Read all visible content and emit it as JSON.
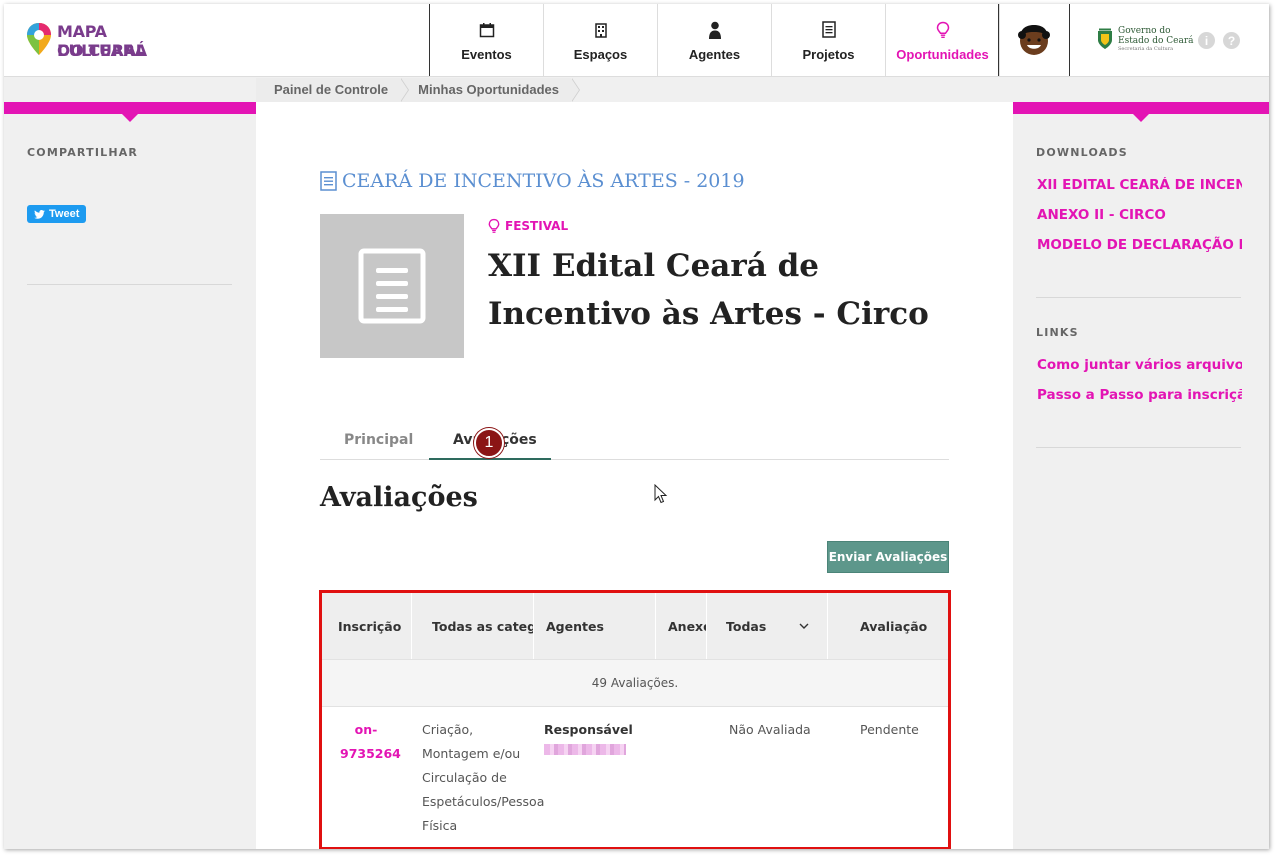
{
  "logo": {
    "line1": "MAPA CULTURAL",
    "line2": "DO CEARÁ"
  },
  "nav": [
    {
      "label": "Eventos",
      "icon": "calendar-icon"
    },
    {
      "label": "Espaços",
      "icon": "building-icon"
    },
    {
      "label": "Agentes",
      "icon": "person-icon"
    },
    {
      "label": "Projetos",
      "icon": "document-icon"
    },
    {
      "label": "Oportunidades",
      "icon": "lightbulb-icon",
      "active": true
    }
  ],
  "gov": {
    "line1": "Governo do",
    "line2": "Estado do Ceará",
    "line3": "Secretaria da Cultura"
  },
  "help_icons": {
    "info": "i",
    "help": "?"
  },
  "breadcrumb": [
    "Painel de Controle",
    "Minhas Oportunidades"
  ],
  "left_sidebar": {
    "heading": "COMPARTILHAR",
    "tweet_label": "Tweet"
  },
  "right_sidebar": {
    "downloads_heading": "DOWNLOADS",
    "downloads": [
      "XII EDITAL CEARÁ DE INCENTIVO",
      "ANEXO II - CIRCO",
      "MODELO DE DECLARAÇÃO DE"
    ],
    "links_heading": "LINKS",
    "links": [
      "Como juntar vários arquivos em",
      "Passo a Passo para inscrição"
    ]
  },
  "opportunity": {
    "parent_title": "CEARÁ DE INCENTIVO ÀS ARTES - 2019",
    "type": "FESTIVAL",
    "title": "XII Edital Ceará de Incentivo às Artes - Circo"
  },
  "tabs": {
    "principal": "Principal",
    "avaliacoes": "Avaliações",
    "marker": "1"
  },
  "section_title": "Avaliações",
  "send_button": "Enviar Avaliações",
  "table": {
    "headers": [
      "Inscrição",
      "Todas as categorias",
      "Agentes",
      "Anexos",
      "Todas",
      "Avaliação"
    ],
    "count_text": "49 Avaliações.",
    "rows": [
      {
        "inscricao": "on-9735264",
        "categoria": "Criação, Montagem e/ou Circulação de Espetáculos/Pessoa Física",
        "agente_label": "Responsável",
        "status": "Não Avaliada",
        "avaliacao": "Pendente"
      }
    ]
  },
  "colors": {
    "accent": "#e314b4",
    "title_blue": "#5b8fd1",
    "button": "#5d978b",
    "highlight_border": "#e01010"
  }
}
